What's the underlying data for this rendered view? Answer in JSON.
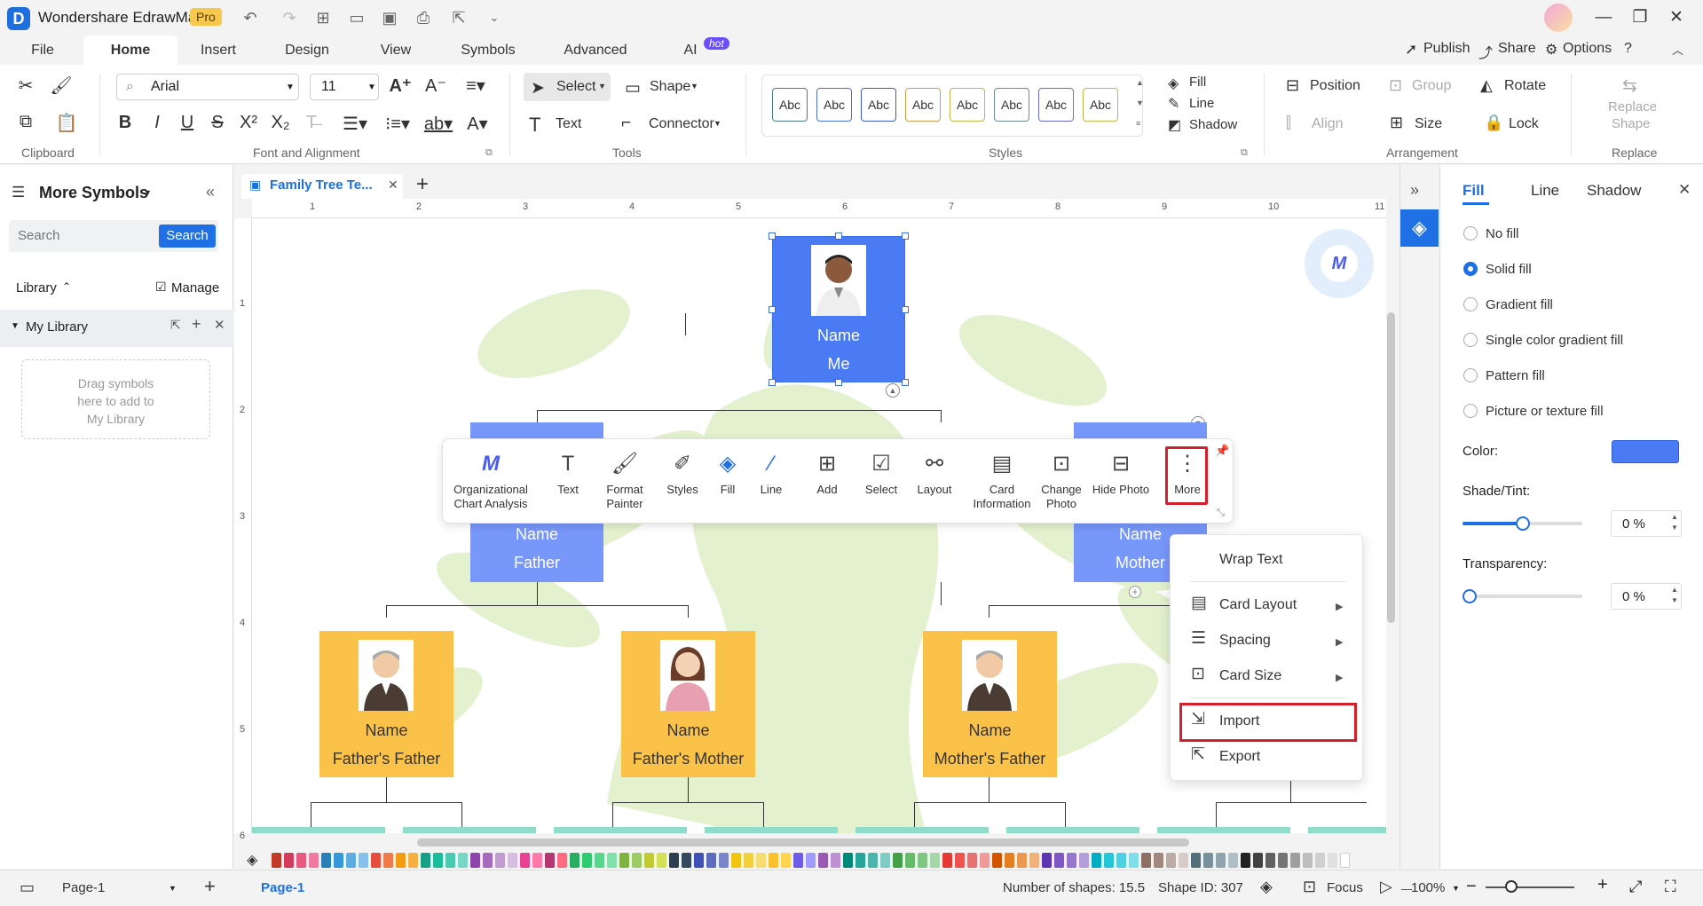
{
  "app": {
    "title": "Wondershare EdrawMax",
    "badge": "Pro"
  },
  "menu": {
    "tabs": [
      "File",
      "Home",
      "Insert",
      "Design",
      "View",
      "Symbols",
      "Advanced",
      "AI"
    ],
    "ai_badge": "hot",
    "right": {
      "publish": "Publish",
      "share": "Share",
      "options": "Options"
    }
  },
  "ribbon": {
    "font_family": "Arial",
    "font_size": "11",
    "select_label": "Select",
    "shape_label": "Shape",
    "text_label": "Text",
    "connector_label": "Connector",
    "style_sample": "Abc",
    "fill_label": "Fill",
    "line_label": "Line",
    "shadow_label": "Shadow",
    "position_label": "Position",
    "group_label": "Group",
    "rotate_label": "Rotate",
    "align_label": "Align",
    "size_label": "Size",
    "lock_label": "Lock",
    "replace_shape_line1": "Replace",
    "replace_shape_line2": "Shape",
    "groups": {
      "clipboard": "Clipboard",
      "font": "Font and Alignment",
      "tools": "Tools",
      "styles": "Styles",
      "arrangement": "Arrangement",
      "replace": "Replace"
    },
    "style_border_colors": [
      "#4a7a8c",
      "#4a6fd4",
      "#3b5cc4",
      "#d49a4a",
      "#c4b44a",
      "#6a8c8c",
      "#6a6ad4",
      "#c4b44a"
    ]
  },
  "left_panel": {
    "title": "More Symbols",
    "search_placeholder": "Search",
    "search_button": "Search",
    "library_label": "Library",
    "manage_label": "Manage",
    "my_library": "My Library",
    "drag_hint_1": "Drag symbols",
    "drag_hint_2": "here to add to",
    "drag_hint_3": "My Library"
  },
  "document": {
    "tab_title": "Family Tree Te...",
    "ruler_h": [
      "1",
      "2",
      "3",
      "4",
      "5",
      "6",
      "7",
      "8",
      "9",
      "10",
      "11"
    ],
    "ruler_v": [
      "1",
      "2",
      "3",
      "4",
      "5",
      "6"
    ]
  },
  "cards": {
    "me": {
      "name": "Name",
      "role": "Me"
    },
    "father": {
      "name": "Name",
      "role": "Father"
    },
    "mother": {
      "name": "Name",
      "role": "Mother"
    },
    "ff": {
      "name": "Name",
      "role": "Father's Father"
    },
    "fm": {
      "name": "Name",
      "role": "Father's Mother"
    },
    "mf": {
      "name": "Name",
      "role": "Mother's Father"
    }
  },
  "context_toolbar": {
    "items": [
      {
        "l1": "Organizational",
        "l2": "Chart Analysis"
      },
      {
        "l1": "Text",
        "l2": ""
      },
      {
        "l1": "Format",
        "l2": "Painter"
      },
      {
        "l1": "Styles",
        "l2": ""
      },
      {
        "l1": "Fill",
        "l2": ""
      },
      {
        "l1": "Line",
        "l2": ""
      },
      {
        "l1": "Add",
        "l2": ""
      },
      {
        "l1": "Select",
        "l2": ""
      },
      {
        "l1": "Layout",
        "l2": ""
      },
      {
        "l1": "Card",
        "l2": "Information"
      },
      {
        "l1": "Change",
        "l2": "Photo"
      },
      {
        "l1": "Hide Photo",
        "l2": ""
      },
      {
        "l1": "More",
        "l2": ""
      }
    ]
  },
  "more_menu": {
    "wrap_text": "Wrap Text",
    "card_layout": "Card Layout",
    "spacing": "Spacing",
    "card_size": "Card Size",
    "import": "Import",
    "export": "Export"
  },
  "right_panel": {
    "tabs": [
      "Fill",
      "Line",
      "Shadow"
    ],
    "options": [
      "No fill",
      "Solid fill",
      "Gradient fill",
      "Single color gradient fill",
      "Pattern fill",
      "Picture or texture fill"
    ],
    "selected_option": "Solid fill",
    "color_label": "Color:",
    "color_value": "#4a7bf5",
    "shade_label": "Shade/Tint:",
    "shade_value": "0 %",
    "shade_level": 0.5,
    "transparency_label": "Transparency:",
    "transparency_value": "0 %",
    "transparency_level": 0
  },
  "status": {
    "page_selector": "Page-1",
    "page_tab": "Page-1",
    "shape_count": "Number of shapes: 15.5",
    "shape_id": "Shape ID: 307",
    "focus": "Focus",
    "zoom": "100%"
  }
}
